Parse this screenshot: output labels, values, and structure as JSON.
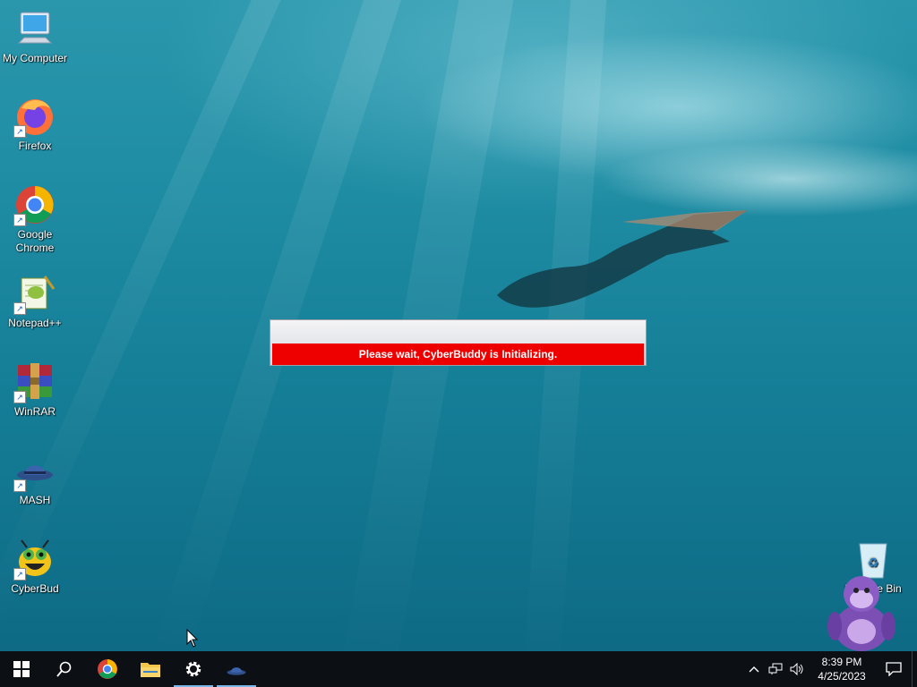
{
  "desktop_icons": [
    {
      "label": "My Computer",
      "icon": "monitor-icon"
    },
    {
      "label": "Firefox",
      "icon": "firefox-icon"
    },
    {
      "label": "Google Chrome",
      "icon": "chrome-icon"
    },
    {
      "label": "Notepad++",
      "icon": "notepad-plus-plus-icon"
    },
    {
      "label": "WinRAR",
      "icon": "winrar-icon"
    },
    {
      "label": "MASH",
      "icon": "mash-hat-icon"
    },
    {
      "label": "CyberBud",
      "icon": "cyberbud-icon"
    },
    {
      "label": "Recycle Bin",
      "icon": "recycle-bin-icon"
    }
  ],
  "dialog": {
    "message": "Please wait, CyberBuddy is Initializing."
  },
  "taskbar": {
    "items": [
      {
        "name": "start-button",
        "icon": "windows-logo-icon"
      },
      {
        "name": "search-button",
        "icon": "search-icon"
      },
      {
        "name": "chrome-taskbar",
        "icon": "chrome-icon"
      },
      {
        "name": "file-explorer-taskbar",
        "icon": "folder-icon"
      },
      {
        "name": "settings-taskbar",
        "icon": "gear-icon"
      },
      {
        "name": "mash-taskbar",
        "icon": "mash-hat-icon"
      }
    ],
    "tray": {
      "time": "8:39 PM",
      "date": "4/25/2023"
    }
  },
  "colors": {
    "dialog_bar": "#ee0000",
    "taskbar": "#0c0f14",
    "active_indicator": "#7bb7e6"
  }
}
